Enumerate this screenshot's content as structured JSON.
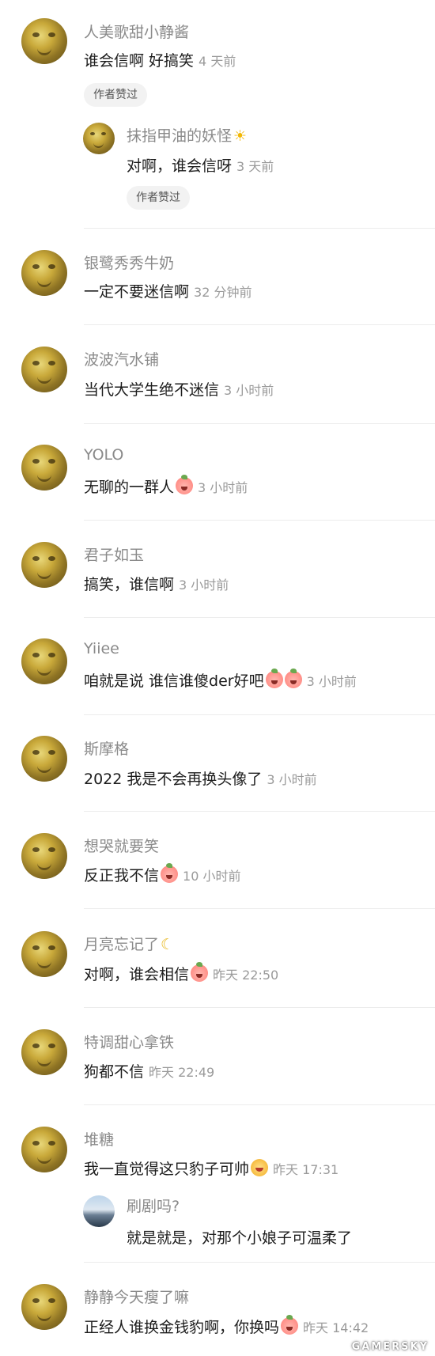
{
  "comments": [
    {
      "name": "人美歌甜小静酱",
      "text": "谁会信啊 好搞笑",
      "time": "4 天前",
      "liked_badge": "作者赞过",
      "reply": {
        "name": "抹指甲油的妖怪",
        "name_icon": "sun-icon",
        "text": "对啊，谁会信呀",
        "time": "3 天前",
        "liked_badge": "作者赞过"
      }
    },
    {
      "name": "银鹭秀秀牛奶",
      "text": "一定不要迷信啊",
      "time": "32 分钟前"
    },
    {
      "name": "波波汽水铺",
      "text": "当代大学生绝不迷信",
      "time": "3 小时前"
    },
    {
      "name": "YOLO",
      "text": "无聊的一群人",
      "emoji": "peach-emoji",
      "time": "3 小时前"
    },
    {
      "name": "君子如玉",
      "text": "搞笑，谁信啊",
      "time": "3 小时前"
    },
    {
      "name": "Yiiee",
      "text": "咱就是说  谁信谁傻der好吧",
      "emoji": "peach-emoji x2",
      "time": "3 小时前"
    },
    {
      "name": "斯摩格",
      "text": "2022 我是不会再换头像了",
      "time": "3 小时前"
    },
    {
      "name": "想哭就要笑",
      "text": "反正我不信",
      "emoji": "peach-emoji",
      "time": "10 小时前"
    },
    {
      "name": "月亮忘记了",
      "name_icon": "moon-icon",
      "text": "对啊，谁会相信",
      "emoji": "peach-emoji",
      "time": "昨天 22:50"
    },
    {
      "name": "特调甜心拿铁",
      "text": "狗都不信",
      "time": "昨天 22:49"
    },
    {
      "name": "堆糖",
      "text": "我一直觉得这只豹子可帅",
      "emoji": "golden-emoji",
      "time": "昨天 17:31",
      "reply": {
        "name": "刷剧吗?",
        "text": "就是就是，对那个小娘子可温柔了"
      }
    },
    {
      "name": "静静今天瘦了嘛",
      "text": "正经人谁换金钱豹啊，你换吗",
      "emoji": "peach-emoji",
      "time": "昨天 14:42"
    }
  ],
  "watermark": "GAMERSKY"
}
